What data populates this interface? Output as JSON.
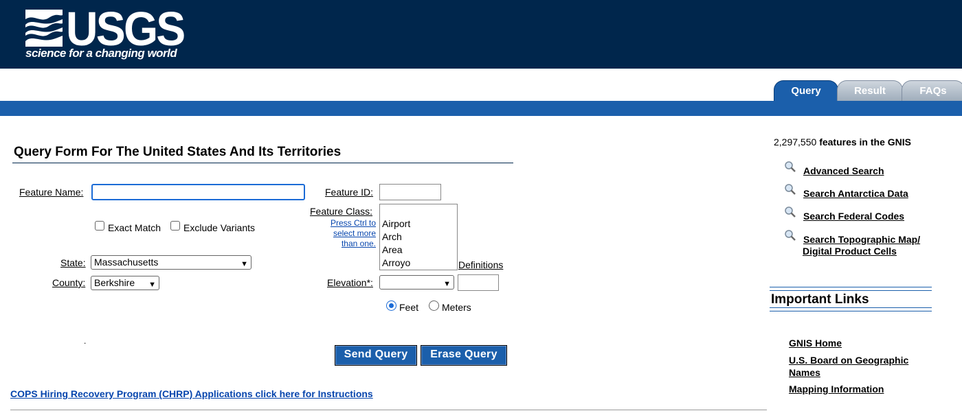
{
  "brand": {
    "logo_text": "USGS",
    "tagline": "science for a changing world",
    "colors": {
      "header": "#00264c",
      "accent_blue": "#1b5fab"
    }
  },
  "tabs": [
    {
      "label": "Query",
      "active": true
    },
    {
      "label": "Result",
      "active": false
    },
    {
      "label": "FAQs",
      "active": false
    }
  ],
  "form": {
    "title": "Query Form For The United States And Its Territories",
    "feature_name": {
      "label": "Feature Name:",
      "value": ""
    },
    "exact_match": {
      "label": "Exact Match",
      "checked": false
    },
    "exclude_variants": {
      "label": "Exclude Variants",
      "checked": false
    },
    "state": {
      "label": "State:",
      "value": "Massachusetts"
    },
    "county": {
      "label": "County:",
      "value": "Berkshire"
    },
    "feature_id": {
      "label": "Feature ID:",
      "value": ""
    },
    "feature_class": {
      "label": "Feature Class:",
      "hint": [
        "Press Ctrl to",
        "select more",
        "than one."
      ],
      "options": [
        "Airport",
        "Arch",
        "Area",
        "Arroyo"
      ]
    },
    "definitions_link": "Definitions",
    "elevation": {
      "label": "Elevation*:",
      "operator": "",
      "value": ""
    },
    "units": {
      "feet": "Feet",
      "meters": "Meters",
      "selected": "feet"
    },
    "dot": ".",
    "send_button": "Send Query",
    "erase_button": "Erase Query"
  },
  "sidebar": {
    "feature_count": "2,297,550",
    "feature_count_suffix": "features in the GNIS",
    "search_links": [
      {
        "label": "Advanced Search",
        "icon": "magnifier-icon"
      },
      {
        "label": "Search Antarctica Data",
        "icon": "magnifier-icon"
      },
      {
        "label": "Search Federal Codes",
        "icon": "magnifier-icon"
      },
      {
        "label": "Search Topographic Map/",
        "label2": "Digital Product Cells",
        "icon": "magnifier-icon"
      }
    ],
    "important_links_title": "Important Links",
    "important_links": [
      {
        "label": "GNIS Home"
      },
      {
        "label": "U.S. Board on Geographic",
        "label2": "Names"
      },
      {
        "label": "Mapping Information"
      }
    ]
  },
  "footer": {
    "cops_link": "COPS Hiring Recovery Program (CHRP) Applications click here for Instructions"
  }
}
